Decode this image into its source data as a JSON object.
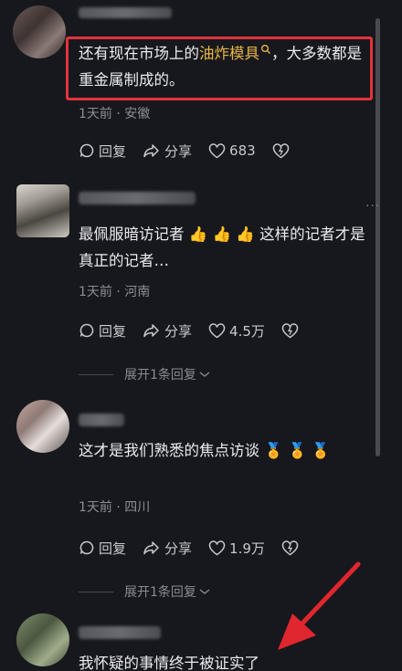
{
  "comments": [
    {
      "text_pre": "还有现在市场上的",
      "keyword": "油炸模具",
      "text_post": "，大多数都是重金属制成的。",
      "meta": "1天前 · 安徽",
      "reply": "回复",
      "share": "分享",
      "likes": "683"
    },
    {
      "text": "最佩服暗访记者 👍 👍 👍 这样的记者才是真正的记者…",
      "meta": "1天前 · 河南",
      "reply": "回复",
      "share": "分享",
      "likes": "4.5万",
      "expand": "展开1条回复"
    },
    {
      "text": "这才是我们熟悉的焦点访谈 🏅 🏅 🏅",
      "meta": "1天前 · 四川",
      "reply": "回复",
      "share": "分享",
      "likes": "1.9万",
      "expand": "展开1条回复"
    },
    {
      "text": "我怀疑的事情终于被证实了"
    }
  ],
  "more": "···",
  "colors": {
    "background": "#17181d",
    "highlight": "#e4333b",
    "keyword": "#e8b548",
    "arrow": "#e0262e"
  },
  "icons": [
    "search-icon",
    "reply-icon",
    "share-icon",
    "heart-icon",
    "dislike-icon",
    "chevron-down-icon",
    "arrow-annotation"
  ]
}
